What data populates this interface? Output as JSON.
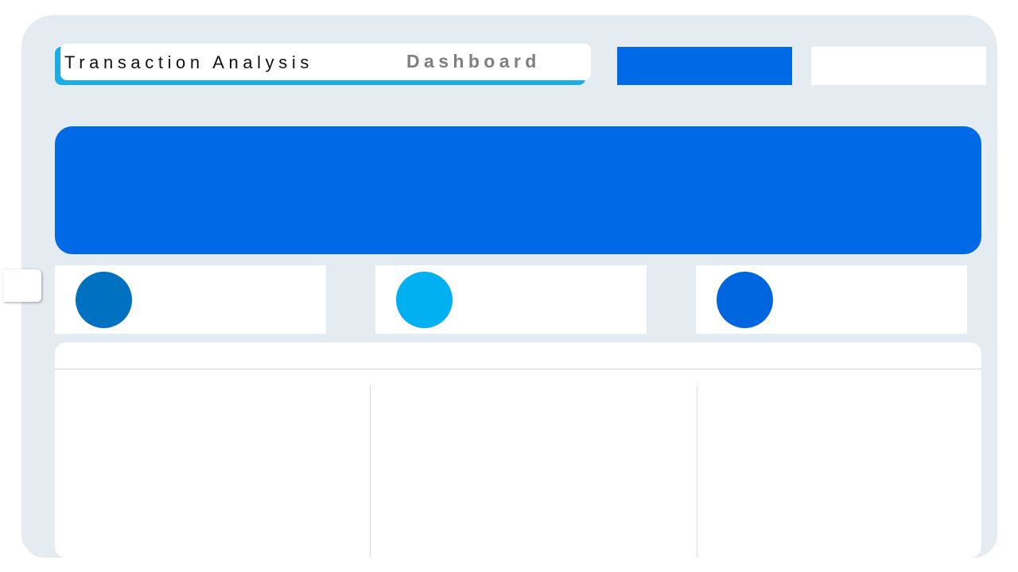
{
  "header": {
    "title": "Transaction Analysis",
    "title_accent": "Dashboard"
  },
  "colors": {
    "background": "#e4ecf2",
    "primary_blue": "#0069e6",
    "accent_cyan": "#1aaee8",
    "kpi_dot_1": "#0070c0",
    "kpi_dot_2": "#00b0f0",
    "kpi_dot_3": "#0066e0",
    "accent_text_gray": "#7f7f7f"
  },
  "kpis": [
    {
      "icon": "circle-indicator-dark-blue"
    },
    {
      "icon": "circle-indicator-cyan"
    },
    {
      "icon": "circle-indicator-blue"
    }
  ],
  "table": {
    "columns": 3
  }
}
